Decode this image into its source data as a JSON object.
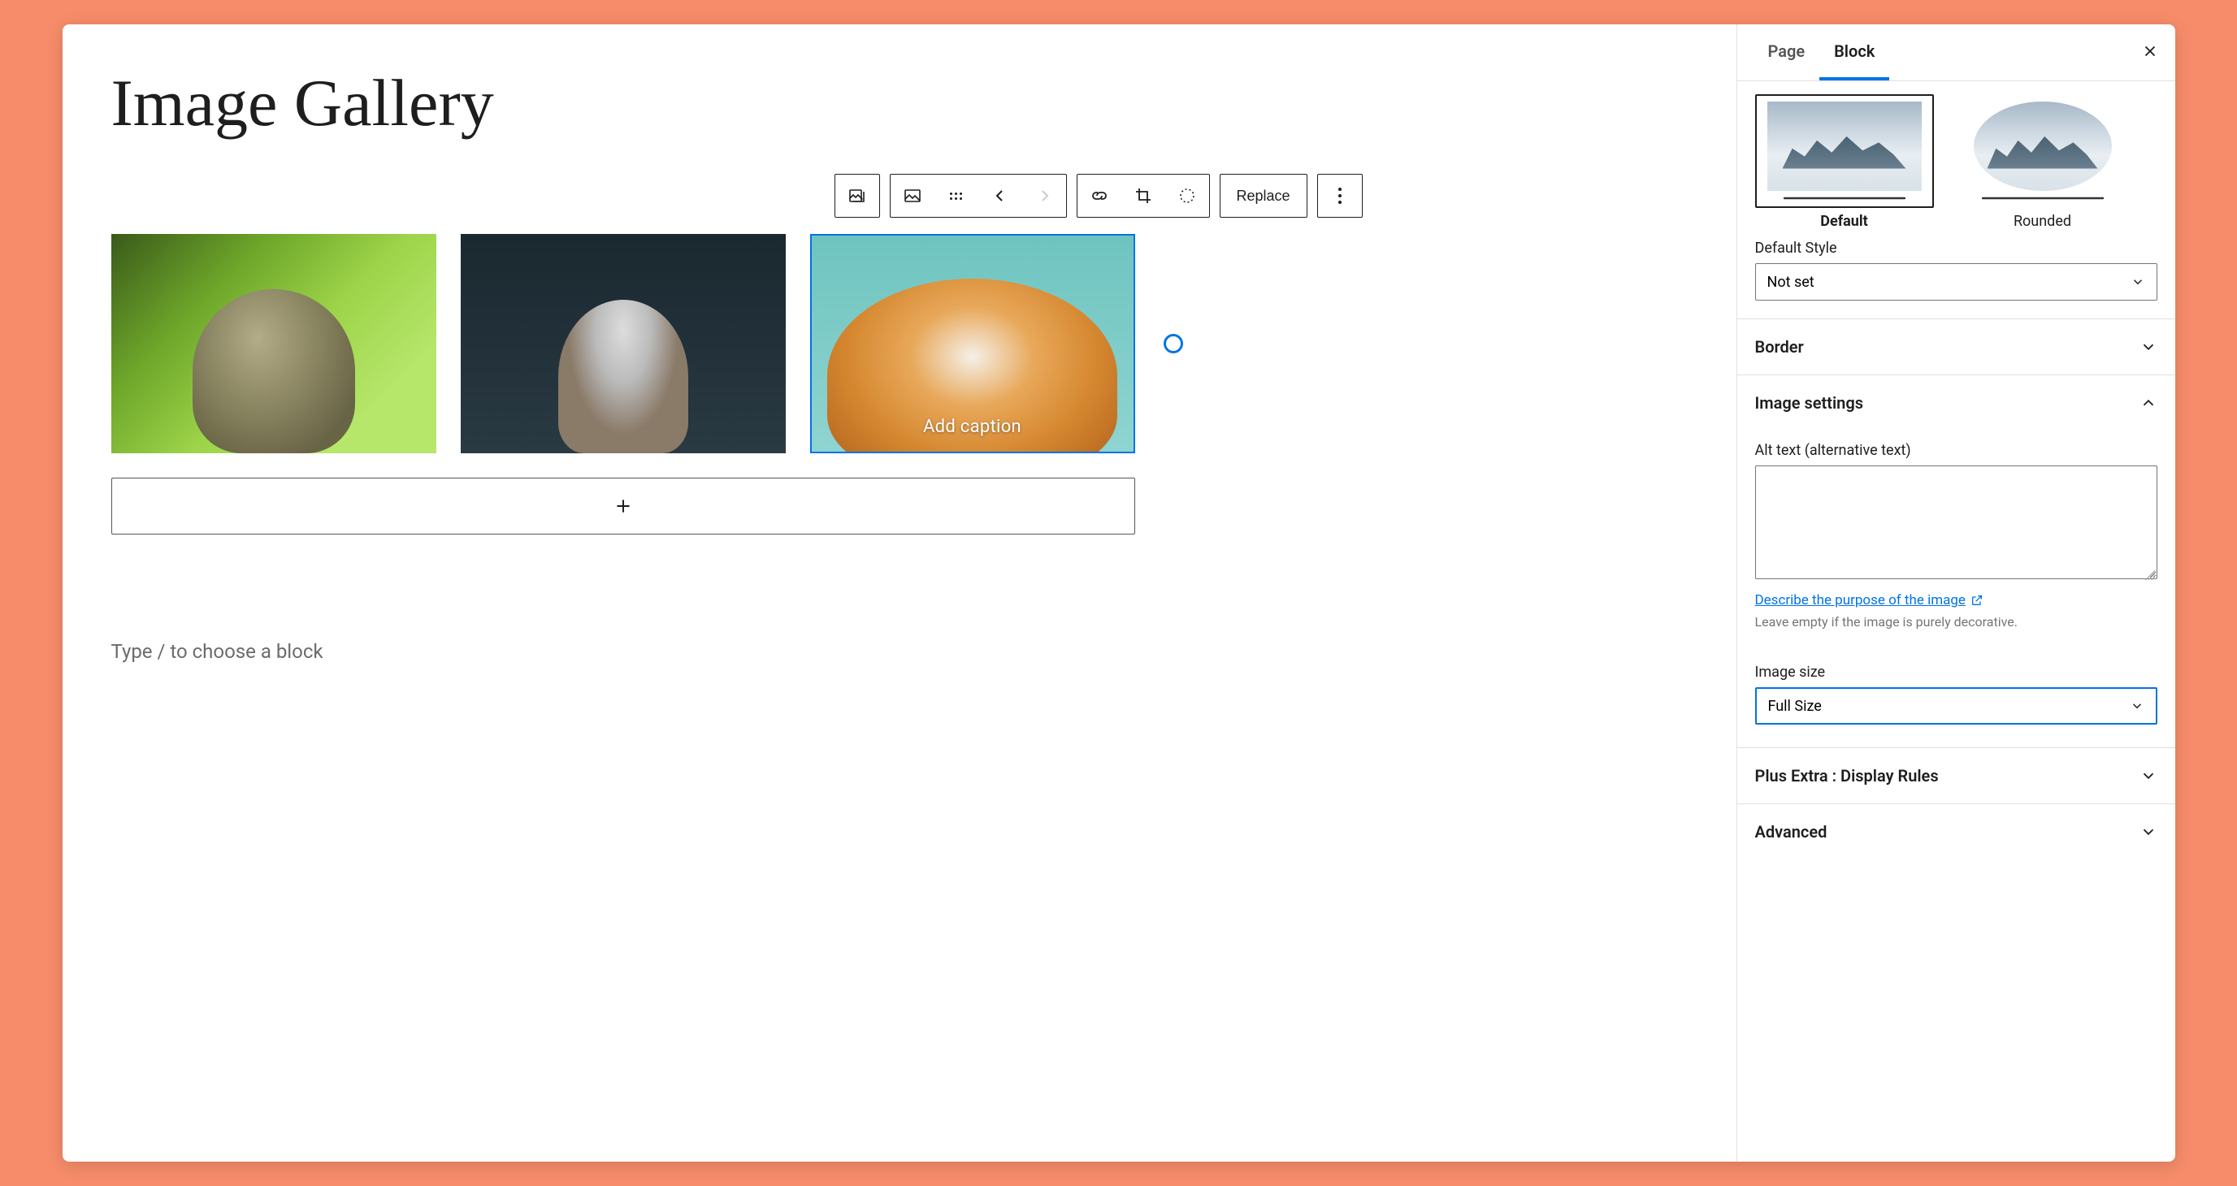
{
  "page_title": "Image Gallery",
  "toolbar": {
    "replace_label": "Replace"
  },
  "gallery": {
    "selected_caption_placeholder": "Add caption"
  },
  "prompt_text": "Type / to choose a block",
  "sidebar": {
    "tabs": {
      "page": "Page",
      "block": "Block",
      "active": "Block"
    },
    "styles": {
      "default_label": "Default",
      "rounded_label": "Rounded",
      "field_label": "Default Style",
      "field_value": "Not set"
    },
    "sections": {
      "border": "Border",
      "image_settings": "Image settings",
      "plus_extra": "Plus Extra : Display Rules",
      "advanced": "Advanced"
    },
    "image_settings": {
      "alt_label": "Alt text (alternative text)",
      "alt_value": "",
      "describe_link": "Describe the purpose of the image",
      "describe_helper": "Leave empty if the image is purely decorative.",
      "size_label": "Image size",
      "size_value": "Full Size"
    }
  }
}
